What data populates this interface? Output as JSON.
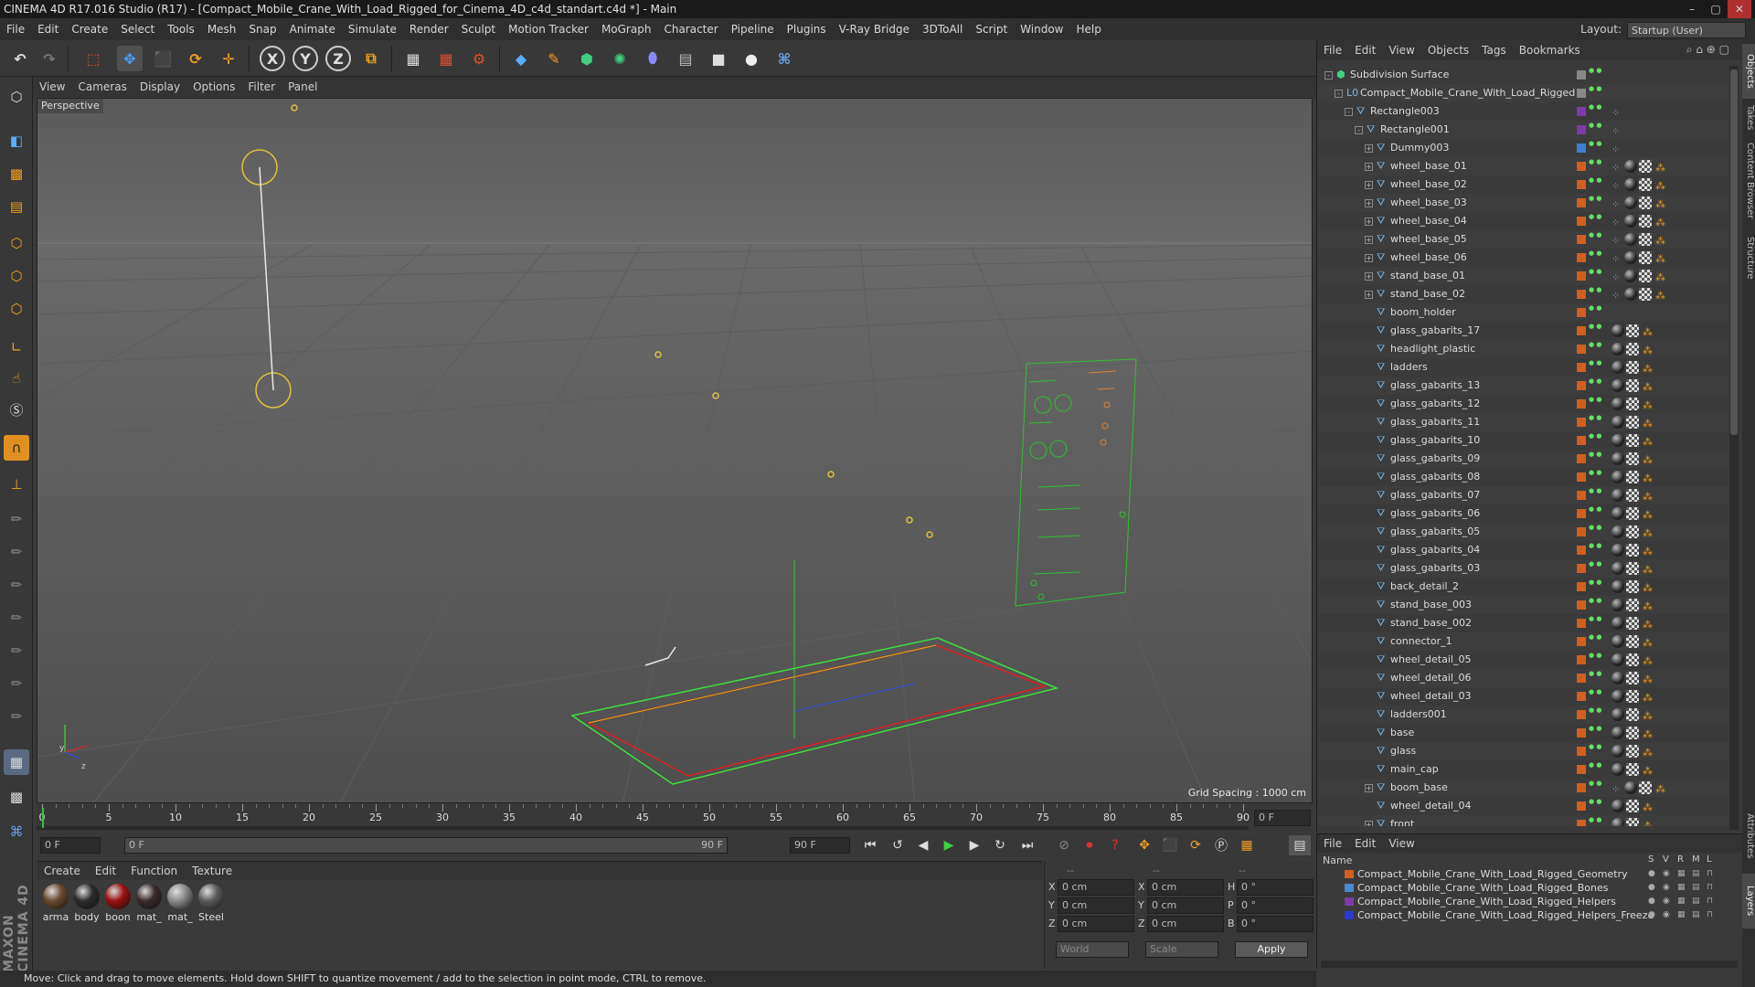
{
  "window": {
    "title": "CINEMA 4D R17.016 Studio (R17) - [Compact_Mobile_Crane_With_Load_Rigged_for_Cinema_4D_c4d_standart.c4d *] - Main",
    "minimize": "–",
    "maximize": "▢",
    "close": "✕"
  },
  "menubar": [
    "File",
    "Edit",
    "Create",
    "Select",
    "Tools",
    "Mesh",
    "Snap",
    "Animate",
    "Simulate",
    "Render",
    "Sculpt",
    "Motion Tracker",
    "MoGraph",
    "Character",
    "Pipeline",
    "Plugins",
    "V-Ray Bridge",
    "3DToAll",
    "Script",
    "Window",
    "Help"
  ],
  "layout": {
    "label": "Layout:",
    "value": "Startup (User)"
  },
  "toolbar": {
    "icons": [
      "undo-icon",
      "redo-icon",
      "live-selection-icon",
      "move-icon",
      "scale-icon",
      "rotate-icon",
      "transform-icon",
      "x-axis-lock-icon",
      "y-axis-lock-icon",
      "z-axis-lock-icon",
      "coordinate-system-icon",
      "render-view-icon",
      "render-picture-viewer-icon",
      "edit-render-settings-icon",
      "cube-icon",
      "pen-spline-icon",
      "subdivision-icon",
      "cloner-icon",
      "deformer-icon",
      "floor-icon",
      "camera-icon",
      "light-icon",
      "python-icon"
    ],
    "axis_x": "X",
    "axis_y": "Y",
    "axis_z": "Z"
  },
  "viewport": {
    "menu": [
      "View",
      "Cameras",
      "Display",
      "Options",
      "Filter",
      "Panel"
    ],
    "label": "Perspective",
    "grid_spacing": "Grid Spacing : 1000 cm",
    "axis_y": "y",
    "axis_z": "z"
  },
  "timeline": {
    "ticks": [
      "0",
      "5",
      "10",
      "15",
      "20",
      "25",
      "30",
      "35",
      "40",
      "45",
      "50",
      "55",
      "60",
      "65",
      "70",
      "75",
      "80",
      "85",
      "90"
    ],
    "current_frame": "0 F",
    "range_start": "0 F",
    "range_slider_start": "0 F",
    "range_slider_end": "90 F",
    "range_end": "90 F",
    "current_fraction": 0.0
  },
  "materials": {
    "menu": [
      "Create",
      "Edit",
      "Function",
      "Texture"
    ],
    "items": [
      {
        "name": "arma",
        "color": "#6b4a2e"
      },
      {
        "name": "body",
        "color": "#2b2b2b"
      },
      {
        "name": "boon",
        "color": "#9b1010"
      },
      {
        "name": "mat_",
        "color": "#3a2a2a"
      },
      {
        "name": "mat_",
        "color": "#8a8a8a"
      },
      {
        "name": "Steel",
        "color": "#5c5c5c"
      }
    ]
  },
  "coordinates": {
    "headers": [
      "--",
      "--",
      "--"
    ],
    "rows": [
      {
        "axis": "X",
        "pos": "0 cm",
        "size_axis": "X",
        "size": "0 cm",
        "rot_axis": "H",
        "rot": "0 °"
      },
      {
        "axis": "Y",
        "pos": "0 cm",
        "size_axis": "Y",
        "size": "0 cm",
        "rot_axis": "P",
        "rot": "0 °"
      },
      {
        "axis": "Z",
        "pos": "0 cm",
        "size_axis": "Z",
        "size": "0 cm",
        "rot_axis": "B",
        "rot": "0 °"
      }
    ],
    "mode": "World",
    "scale": "Scale",
    "apply": "Apply"
  },
  "status": "Move: Click and drag to move elements. Hold down SHIFT to quantize movement / add to the selection in point mode, CTRL to remove.",
  "objects": {
    "menu": [
      "File",
      "Edit",
      "View",
      "Objects",
      "Tags",
      "Bookmarks"
    ],
    "items": [
      {
        "name": "Subdivision Surface",
        "indent": 0,
        "exp": "-",
        "color": "#888888",
        "tags": 0
      },
      {
        "name": "Compact_Mobile_Crane_With_Load_Rigged",
        "indent": 1,
        "exp": "-",
        "color": "#888888",
        "tags": 0
      },
      {
        "name": "Rectangle003",
        "indent": 2,
        "exp": "-",
        "color": "#7a3da8",
        "tags": 1
      },
      {
        "name": "Rectangle001",
        "indent": 3,
        "exp": "-",
        "color": "#7a3da8",
        "tags": 1
      },
      {
        "name": "Dummy003",
        "indent": 4,
        "exp": "+",
        "color": "#3a7fd0",
        "tags": 1
      },
      {
        "name": "wheel_base_01",
        "indent": 4,
        "exp": "+",
        "color": "#d06020",
        "tags": 3
      },
      {
        "name": "wheel_base_02",
        "indent": 4,
        "exp": "+",
        "color": "#d06020",
        "tags": 3
      },
      {
        "name": "wheel_base_03",
        "indent": 4,
        "exp": "+",
        "color": "#d06020",
        "tags": 3
      },
      {
        "name": "wheel_base_04",
        "indent": 4,
        "exp": "+",
        "color": "#d06020",
        "tags": 3
      },
      {
        "name": "wheel_base_05",
        "indent": 4,
        "exp": "+",
        "color": "#d06020",
        "tags": 3
      },
      {
        "name": "wheel_base_06",
        "indent": 4,
        "exp": "+",
        "color": "#d06020",
        "tags": 3
      },
      {
        "name": "stand_base_01",
        "indent": 4,
        "exp": "+",
        "color": "#d06020",
        "tags": 3
      },
      {
        "name": "stand_base_02",
        "indent": 4,
        "exp": "+",
        "color": "#d06020",
        "tags": 3
      },
      {
        "name": "boom_holder",
        "indent": 4,
        "exp": "",
        "color": "#d06020",
        "tags": 0
      },
      {
        "name": "glass_gabarits_17",
        "indent": 4,
        "exp": "",
        "color": "#d06020",
        "tags": 2
      },
      {
        "name": "headlight_plastic",
        "indent": 4,
        "exp": "",
        "color": "#d06020",
        "tags": 2
      },
      {
        "name": "ladders",
        "indent": 4,
        "exp": "",
        "color": "#d06020",
        "tags": 2
      },
      {
        "name": "glass_gabarits_13",
        "indent": 4,
        "exp": "",
        "color": "#d06020",
        "tags": 2
      },
      {
        "name": "glass_gabarits_12",
        "indent": 4,
        "exp": "",
        "color": "#d06020",
        "tags": 2
      },
      {
        "name": "glass_gabarits_11",
        "indent": 4,
        "exp": "",
        "color": "#d06020",
        "tags": 2
      },
      {
        "name": "glass_gabarits_10",
        "indent": 4,
        "exp": "",
        "color": "#d06020",
        "tags": 2
      },
      {
        "name": "glass_gabarits_09",
        "indent": 4,
        "exp": "",
        "color": "#d06020",
        "tags": 2
      },
      {
        "name": "glass_gabarits_08",
        "indent": 4,
        "exp": "",
        "color": "#d06020",
        "tags": 2
      },
      {
        "name": "glass_gabarits_07",
        "indent": 4,
        "exp": "",
        "color": "#d06020",
        "tags": 2
      },
      {
        "name": "glass_gabarits_06",
        "indent": 4,
        "exp": "",
        "color": "#d06020",
        "tags": 2
      },
      {
        "name": "glass_gabarits_05",
        "indent": 4,
        "exp": "",
        "color": "#d06020",
        "tags": 2
      },
      {
        "name": "glass_gabarits_04",
        "indent": 4,
        "exp": "",
        "color": "#d06020",
        "tags": 2
      },
      {
        "name": "glass_gabarits_03",
        "indent": 4,
        "exp": "",
        "color": "#d06020",
        "tags": 2
      },
      {
        "name": "back_detail_2",
        "indent": 4,
        "exp": "",
        "color": "#d06020",
        "tags": 2
      },
      {
        "name": "stand_base_003",
        "indent": 4,
        "exp": "",
        "color": "#d06020",
        "tags": 2
      },
      {
        "name": "stand_base_002",
        "indent": 4,
        "exp": "",
        "color": "#d06020",
        "tags": 2
      },
      {
        "name": "connector_1",
        "indent": 4,
        "exp": "",
        "color": "#d06020",
        "tags": 2
      },
      {
        "name": "wheel_detail_05",
        "indent": 4,
        "exp": "",
        "color": "#d06020",
        "tags": 2
      },
      {
        "name": "wheel_detail_06",
        "indent": 4,
        "exp": "",
        "color": "#d06020",
        "tags": 2
      },
      {
        "name": "wheel_detail_03",
        "indent": 4,
        "exp": "",
        "color": "#d06020",
        "tags": 2
      },
      {
        "name": "ladders001",
        "indent": 4,
        "exp": "",
        "color": "#d06020",
        "tags": 2
      },
      {
        "name": "base",
        "indent": 4,
        "exp": "",
        "color": "#d06020",
        "tags": 2
      },
      {
        "name": "glass",
        "indent": 4,
        "exp": "",
        "color": "#d06020",
        "tags": 2
      },
      {
        "name": "main_cap",
        "indent": 4,
        "exp": "",
        "color": "#d06020",
        "tags": 2
      },
      {
        "name": "boom_base",
        "indent": 4,
        "exp": "+",
        "color": "#d06020",
        "tags": 3
      },
      {
        "name": "wheel_detail_04",
        "indent": 4,
        "exp": "",
        "color": "#d06020",
        "tags": 2
      },
      {
        "name": "front",
        "indent": 4,
        "exp": "+",
        "color": "#d06020",
        "tags": 2
      }
    ]
  },
  "layers": {
    "menu": [
      "File",
      "Edit",
      "View"
    ],
    "header_name": "Name",
    "header_cols": [
      "S",
      "V",
      "R",
      "M",
      "L"
    ],
    "items": [
      {
        "name": "Compact_Mobile_Crane_With_Load_Rigged_Geometry",
        "color": "#d06020"
      },
      {
        "name": "Compact_Mobile_Crane_With_Load_Rigged_Bones",
        "color": "#4a8ad0"
      },
      {
        "name": "Compact_Mobile_Crane_With_Load_Rigged_Helpers",
        "color": "#7a3da8"
      },
      {
        "name": "Compact_Mobile_Crane_With_Load_Rigged_Helpers_Freeze",
        "color": "#2a3ad0"
      }
    ]
  },
  "side_tabs": [
    "Objects",
    "Takes",
    "Content Browser",
    "Structure",
    "Attributes",
    "Layers"
  ],
  "branding": "MAXON CINEMA 4D"
}
